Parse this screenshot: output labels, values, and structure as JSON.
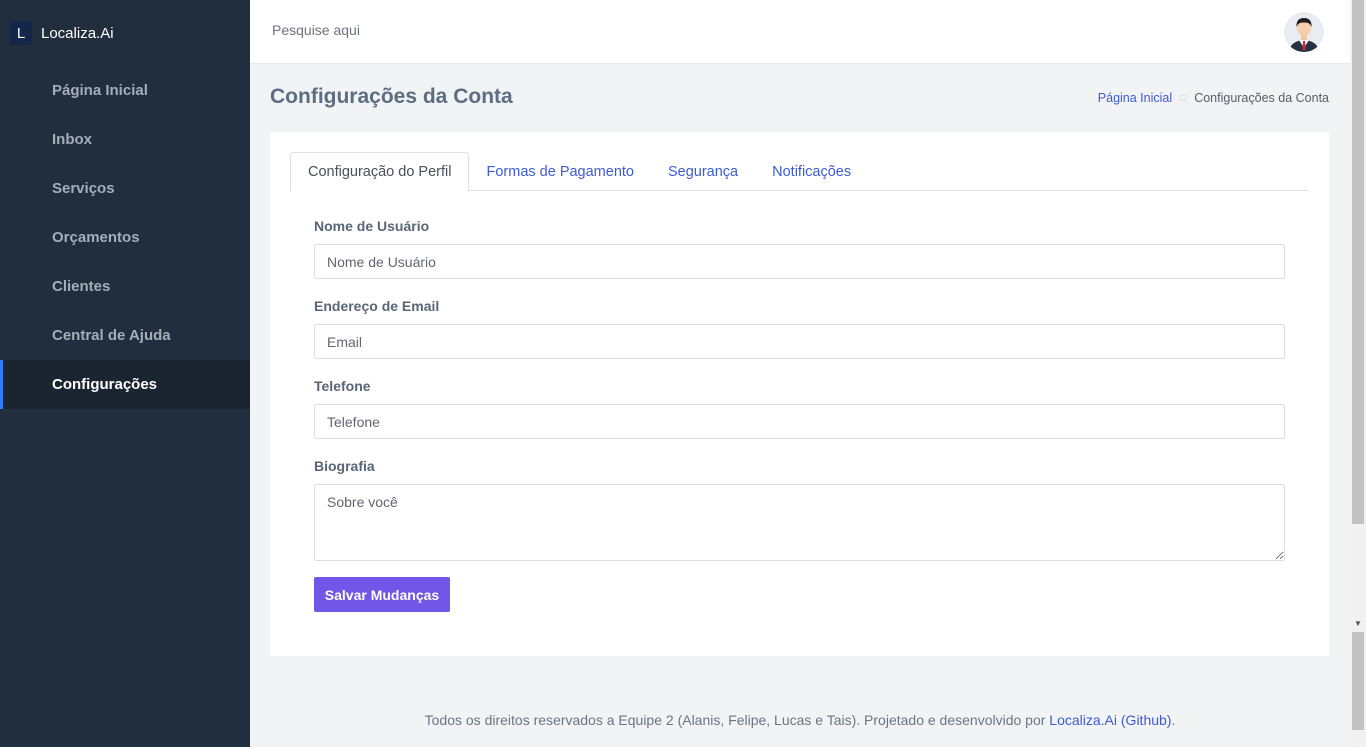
{
  "brand": {
    "logo_letter": "L",
    "name": "Localiza.Ai"
  },
  "sidebar": {
    "items": [
      {
        "label": "Página Inicial"
      },
      {
        "label": "Inbox"
      },
      {
        "label": "Serviços"
      },
      {
        "label": "Orçamentos"
      },
      {
        "label": "Clientes"
      },
      {
        "label": "Central de Ajuda"
      },
      {
        "label": "Configurações",
        "active": true
      }
    ]
  },
  "topbar": {
    "search_placeholder": "Pesquise aqui",
    "avatar_icon": "user-avatar-icon"
  },
  "page": {
    "title": "Configurações da Conta",
    "breadcrumb": {
      "home": "Página Inicial",
      "current": "Configurações da Conta"
    }
  },
  "tabs": [
    {
      "label": "Configuração do Perfil",
      "active": true
    },
    {
      "label": "Formas de Pagamento"
    },
    {
      "label": "Segurança"
    },
    {
      "label": "Notificações"
    }
  ],
  "form": {
    "username": {
      "label": "Nome de Usuário",
      "placeholder": "Nome de Usuário",
      "value": ""
    },
    "email": {
      "label": "Endereço de Email",
      "placeholder": "Email",
      "value": ""
    },
    "phone": {
      "label": "Telefone",
      "placeholder": "Telefone",
      "value": ""
    },
    "bio": {
      "label": "Biografia",
      "placeholder": "Sobre você",
      "value": ""
    },
    "save_label": "Salvar Mudanças"
  },
  "footer": {
    "text": "Todos os direitos reservados a Equipe 2 (Alanis, Felipe, Lucas e Tais). Projetado e desenvolvido por ",
    "link": "Localiza.Ai (Github)",
    "end": "."
  },
  "colors": {
    "sidebar_bg": "#212e3e",
    "active_indicator": "#2d7cf6",
    "link": "#3d5bd6",
    "primary_button": "#7057e8"
  }
}
